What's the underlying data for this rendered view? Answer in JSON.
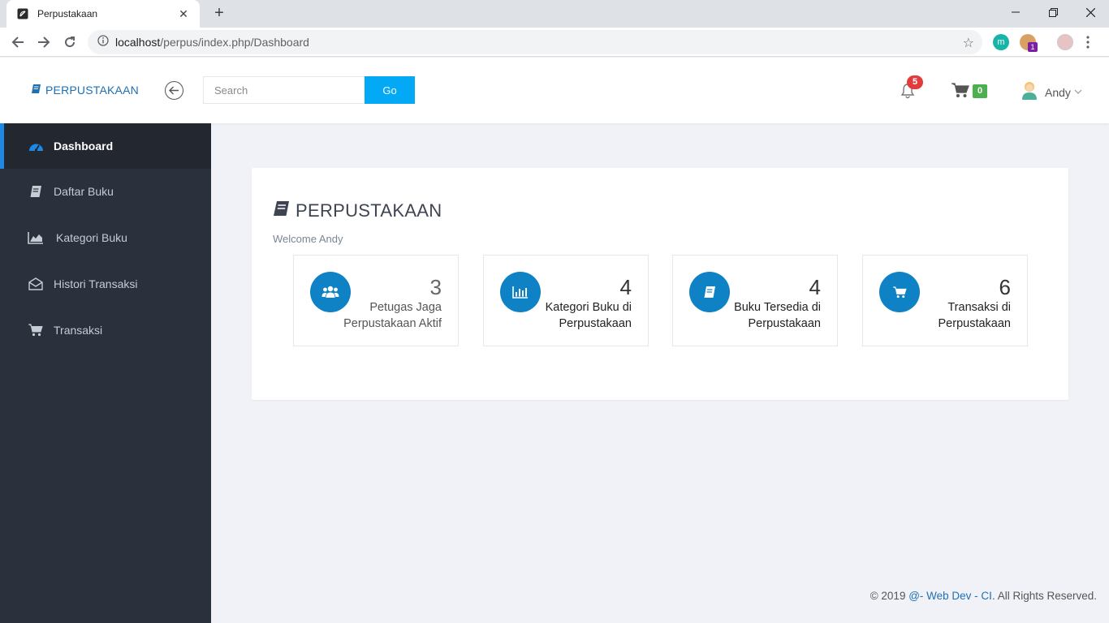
{
  "browser": {
    "tab_title": "Perpustakaan",
    "url_host": "localhost",
    "url_path": "/perpus/index.php/Dashboard",
    "ext_badge": "1"
  },
  "header": {
    "brand": "PERPUSTAKAAN",
    "search_placeholder": "Search",
    "go_label": "Go",
    "notif_count": "5",
    "cart_count": "0",
    "user_name": "Andy"
  },
  "sidebar": {
    "items": [
      {
        "label": "Dashboard",
        "icon": "dashboard-icon",
        "active": true
      },
      {
        "label": "Daftar Buku",
        "icon": "book-icon"
      },
      {
        "label": "Kategori Buku",
        "icon": "area-chart-icon"
      },
      {
        "label": "Histori Transaksi",
        "icon": "envelope-icon"
      },
      {
        "label": "Transaksi",
        "icon": "cart-icon"
      }
    ]
  },
  "main": {
    "title": "PERPUSTAKAAN",
    "welcome": "Welcome Andy",
    "stats": [
      {
        "value": "3",
        "label": "Petugas Jaga Perpustakaan Aktif",
        "icon": "users-icon"
      },
      {
        "value": "4",
        "label": "Kategori Buku di Perpustakaan",
        "icon": "bar-chart-icon"
      },
      {
        "value": "4",
        "label": "Buku Tersedia di Perpustakaan",
        "icon": "book-icon"
      },
      {
        "value": "6",
        "label": "Transaksi di Perpustakaan",
        "icon": "cart-icon"
      }
    ]
  },
  "footer": {
    "prefix": "© 2019 ",
    "link": "@- Web Dev - CI",
    "suffix": ". All Rights Reserved."
  },
  "colors": {
    "accent": "#03a9f4",
    "stat_icon_bg": "#0f82c6",
    "sidebar_bg": "#2a303c",
    "notif_badge": "#e23b3b",
    "cart_badge": "#4caf50"
  }
}
